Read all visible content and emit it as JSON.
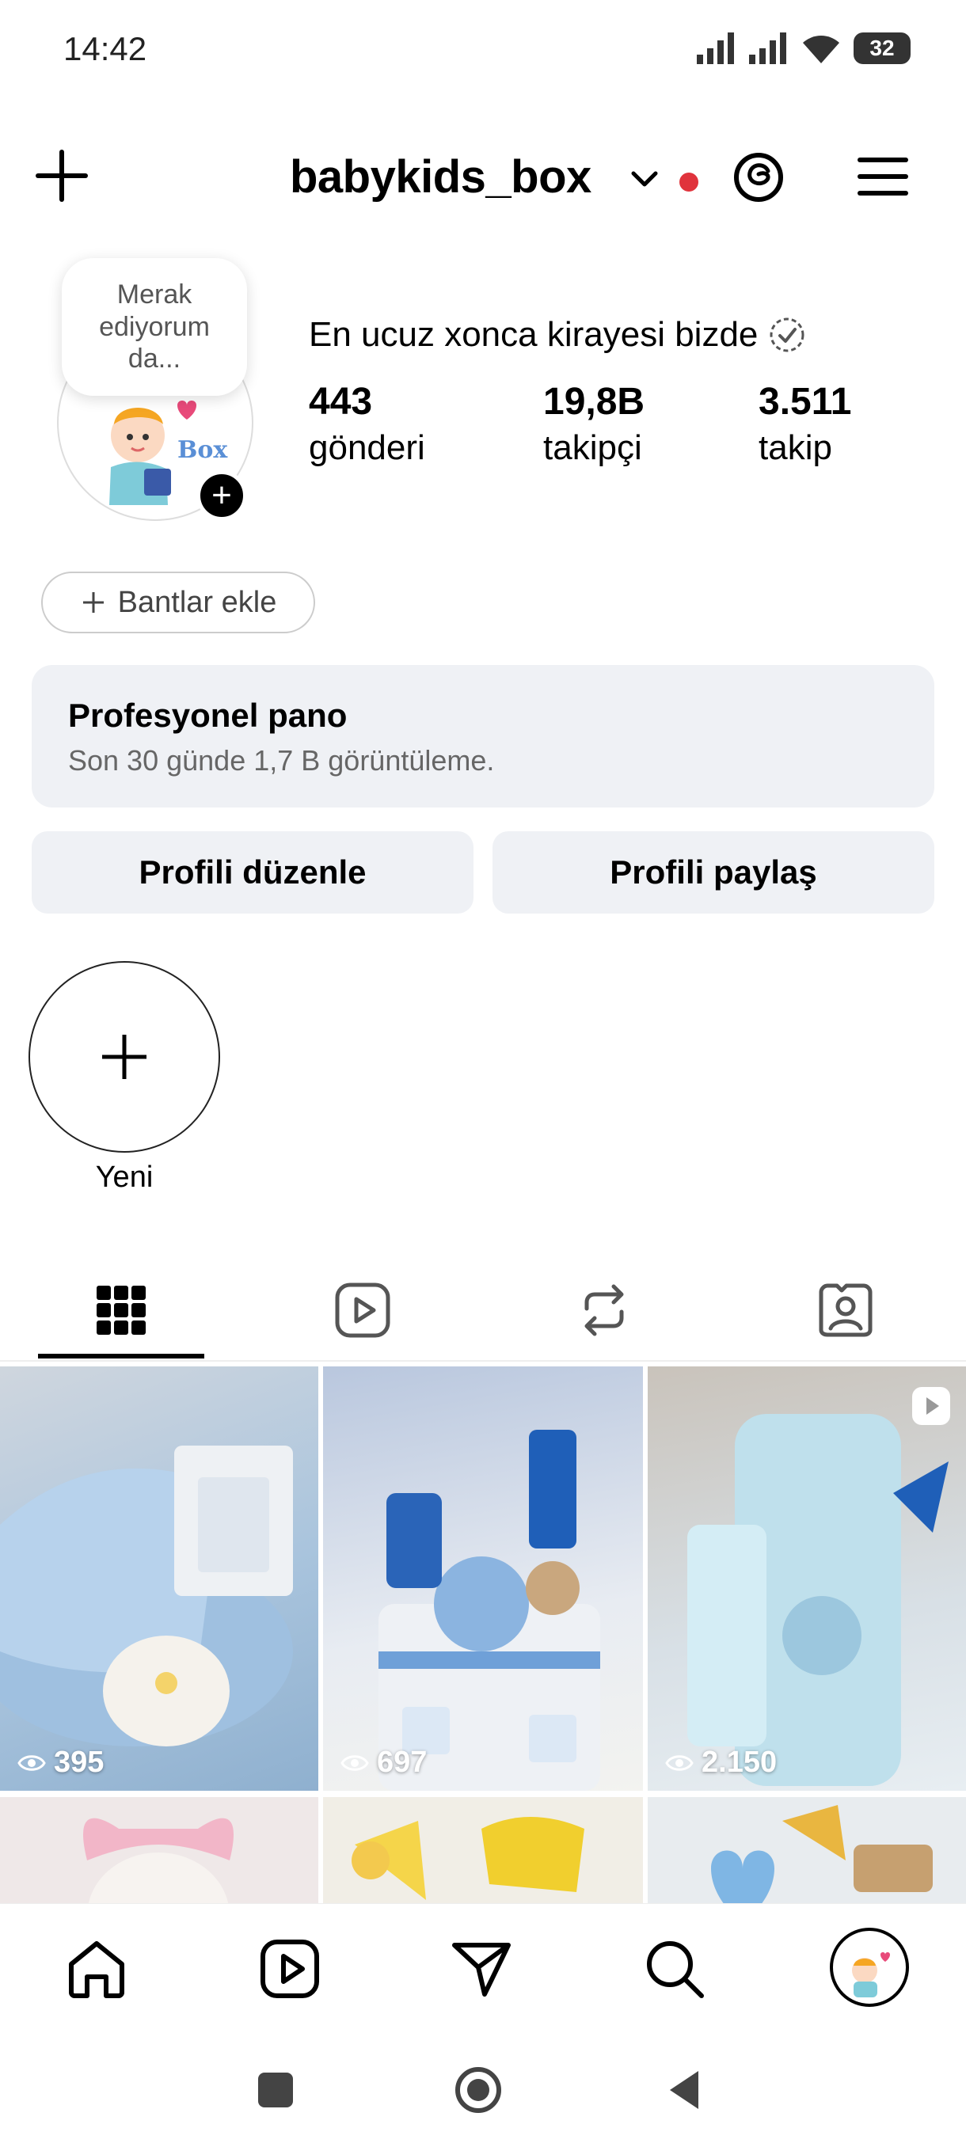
{
  "status_bar": {
    "time": "14:42",
    "battery": "32"
  },
  "header": {
    "username": "babykids_box"
  },
  "profile": {
    "note": "Merak ediyorum da...",
    "display_name": "En ucuz xonca kirayesi bizde",
    "avatar_logo_text": "Box",
    "stats": [
      {
        "value": "443",
        "label": "gönderi"
      },
      {
        "value": "19,8B",
        "label": "takipçi"
      },
      {
        "value": "3.511",
        "label": "takip"
      }
    ]
  },
  "bands_button": {
    "label": "Bantlar ekle"
  },
  "dashboard": {
    "title": "Profesyonel pano",
    "subtitle": "Son 30 günde 1,7 B görüntüleme."
  },
  "actions": {
    "edit_label": "Profili düzenle",
    "share_label": "Profili paylaş"
  },
  "highlights": {
    "new_label": "Yeni"
  },
  "tabs": [
    "grid-icon",
    "reels-icon",
    "reposts-icon",
    "tagged-icon"
  ],
  "posts": [
    {
      "views": "395",
      "is_reel": false
    },
    {
      "views": "697",
      "is_reel": false
    },
    {
      "views": "2.150",
      "is_reel": true
    }
  ],
  "colors": {
    "accent_red": "#e0333c",
    "button_bg": "#eff1f5",
    "baby_blue": "#a9c9e8",
    "pink": "#f2b6c8"
  }
}
